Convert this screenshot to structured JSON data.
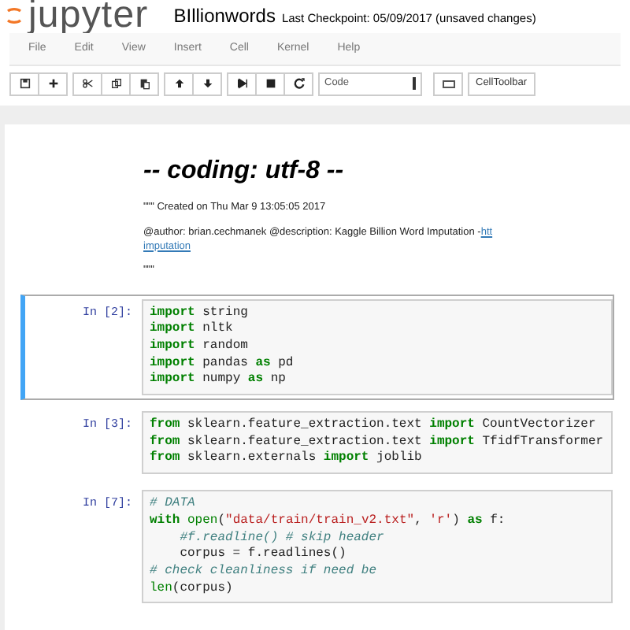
{
  "header": {
    "logo": "jupyter",
    "title": "BIllionwords",
    "checkpoint": "Last Checkpoint: 05/09/2017 (unsaved changes)"
  },
  "menu": [
    "File",
    "Edit",
    "View",
    "Insert",
    "Cell",
    "Kernel",
    "Help"
  ],
  "toolbar": {
    "groups": [
      [
        {
          "kind": "save"
        },
        {
          "kind": "plus"
        }
      ],
      [
        {
          "kind": "cut"
        },
        {
          "kind": "copy"
        },
        {
          "kind": "paste"
        }
      ],
      [
        {
          "kind": "up"
        },
        {
          "kind": "down"
        }
      ],
      [
        {
          "kind": "step"
        },
        {
          "kind": "stop"
        },
        {
          "kind": "restart"
        }
      ]
    ],
    "cell_type": "Code",
    "celltoolbar": "CellToolbar"
  },
  "markdown": {
    "heading": "-- coding: utf-8 --",
    "created": "\"\"\" Created on Thu Mar 9 13:05:05 2017",
    "author": "@author: brian.cechmanek @description: Kaggle Billion Word Imputation - ",
    "link_start": "htt",
    "link_end": "imputation",
    "closing": "\"\"\""
  },
  "cells": [
    {
      "prompt": "In [2]:",
      "selected": true,
      "lines": [
        [
          {
            "kind": "kw",
            "text": "import"
          },
          {
            "kind": "plain",
            "text": " string"
          }
        ],
        [
          {
            "kind": "kw",
            "text": "import"
          },
          {
            "kind": "plain",
            "text": " nltk"
          }
        ],
        [
          {
            "kind": "kw",
            "text": "import"
          },
          {
            "kind": "plain",
            "text": " random"
          }
        ],
        [
          {
            "kind": "kw",
            "text": "import"
          },
          {
            "kind": "plain",
            "text": " pandas "
          },
          {
            "kind": "kw",
            "text": "as"
          },
          {
            "kind": "plain",
            "text": " pd"
          }
        ],
        [
          {
            "kind": "kw",
            "text": "import"
          },
          {
            "kind": "plain",
            "text": " numpy "
          },
          {
            "kind": "kw",
            "text": "as"
          },
          {
            "kind": "plain",
            "text": " np"
          }
        ]
      ]
    },
    {
      "prompt": "In [3]:",
      "selected": false,
      "lines": [
        [
          {
            "kind": "kw",
            "text": "from"
          },
          {
            "kind": "plain",
            "text": " sklearn.feature_extraction.text "
          },
          {
            "kind": "kw",
            "text": "import"
          },
          {
            "kind": "plain",
            "text": " CountVectorizer"
          }
        ],
        [
          {
            "kind": "kw",
            "text": "from"
          },
          {
            "kind": "plain",
            "text": " sklearn.feature_extraction.text "
          },
          {
            "kind": "kw",
            "text": "import"
          },
          {
            "kind": "plain",
            "text": " TfidfTransformer"
          }
        ],
        [
          {
            "kind": "kw",
            "text": "from"
          },
          {
            "kind": "plain",
            "text": " sklearn.externals "
          },
          {
            "kind": "kw",
            "text": "import"
          },
          {
            "kind": "plain",
            "text": " joblib"
          }
        ]
      ]
    },
    {
      "prompt": "In [7]:",
      "selected": false,
      "lines": [
        [
          {
            "kind": "comment",
            "text": "# DATA"
          }
        ],
        [
          {
            "kind": "kw",
            "text": "with"
          },
          {
            "kind": "builtin",
            "text": " open"
          },
          {
            "kind": "plain",
            "text": "("
          },
          {
            "kind": "string",
            "text": "\"data/train/train_v2.txt\""
          },
          {
            "kind": "plain",
            "text": ", "
          },
          {
            "kind": "string",
            "text": "'r'"
          },
          {
            "kind": "plain",
            "text": ") "
          },
          {
            "kind": "kw",
            "text": "as"
          },
          {
            "kind": "plain",
            "text": " f:"
          }
        ],
        [
          {
            "kind": "comment",
            "text": "    #f.readline() # skip header"
          }
        ],
        [
          {
            "kind": "plain",
            "text": "    corpus = f.readlines()"
          }
        ],
        [
          {
            "kind": "comment",
            "text": "# check cleanliness if need be"
          }
        ],
        [
          {
            "kind": "builtin",
            "text": "len"
          },
          {
            "kind": "plain",
            "text": "(corpus)"
          }
        ]
      ]
    }
  ]
}
